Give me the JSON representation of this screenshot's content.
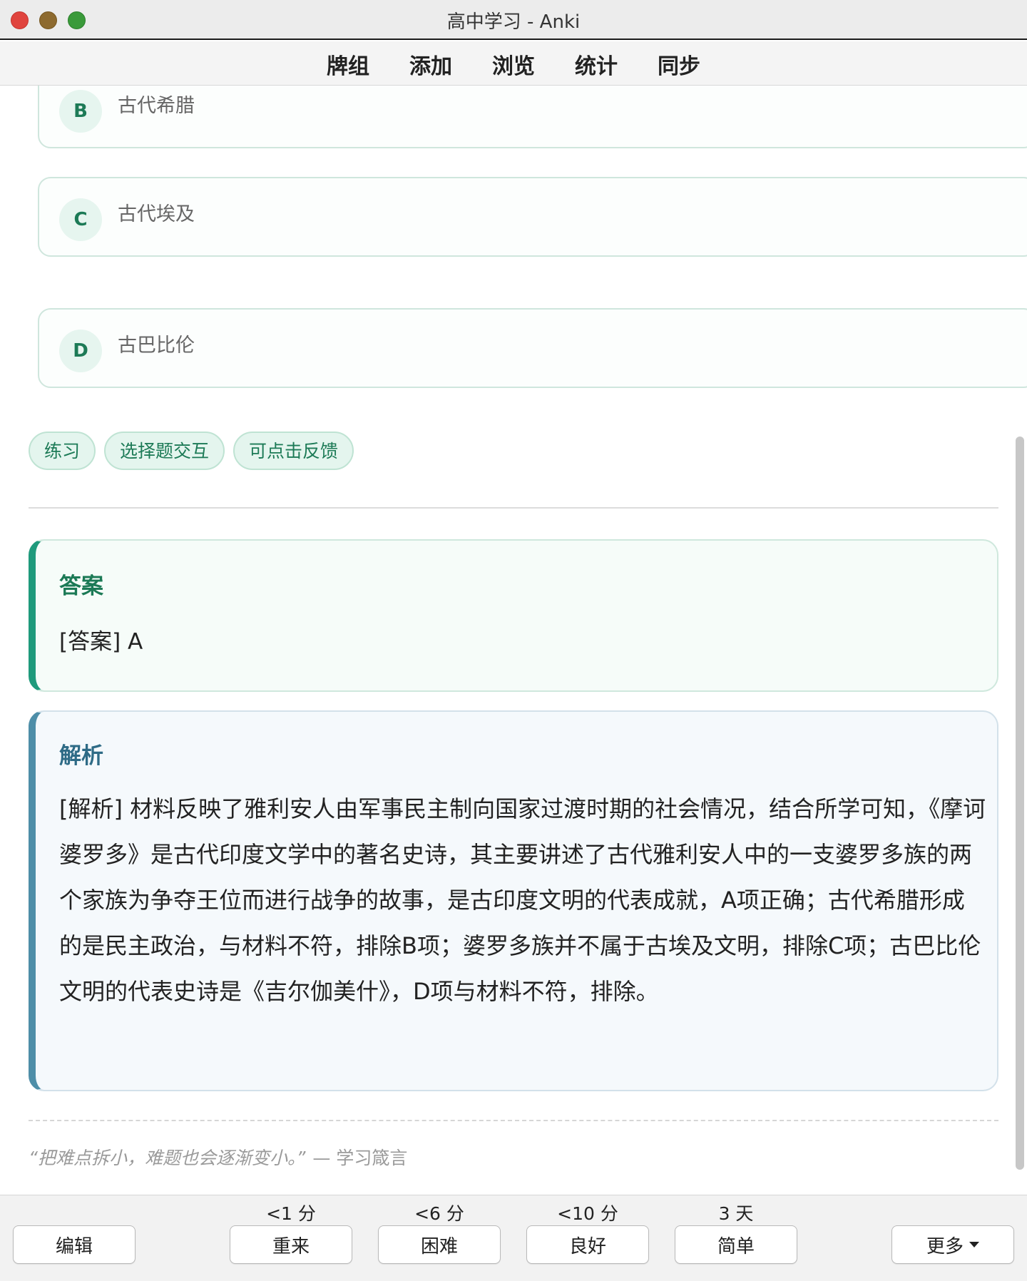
{
  "window": {
    "title": "高中学习 - Anki"
  },
  "toolbar": {
    "items": [
      "牌组",
      "添加",
      "浏览",
      "统计",
      "同步"
    ]
  },
  "card": {
    "options": [
      {
        "letter": "B",
        "text": "古代希腊"
      },
      {
        "letter": "C",
        "text": "古代埃及"
      },
      {
        "letter": "D",
        "text": "古巴比伦"
      }
    ],
    "tags": [
      "练习",
      "选择题交互",
      "可点击反馈"
    ],
    "answer": {
      "title": "答案",
      "text": "[答案] A"
    },
    "analysis": {
      "title": "解析",
      "text": "[解析] 材料反映了雅利安人由军事民主制向国家过渡时期的社会情况，结合所学可知，《摩诃婆罗多》是古代印度文学中的著名史诗，其主要讲述了古代雅利安人中的一支婆罗多族的两个家族为争夺王位而进行战争的故事，是古印度文明的代表成就，A项正确；古代希腊形成的是民主政治，与材料不符，排除B项；婆罗多族并不属于古埃及文明，排除C项；古巴比伦文明的代表史诗是《吉尔伽美什》，D项与材料不符，排除。"
    },
    "quote": {
      "text": "“把难点拆小，难题也会逐渐变小。”",
      "author": "— 学习箴言"
    }
  },
  "bottombar": {
    "edit_label": "编辑",
    "more_label": "更多",
    "answers": [
      {
        "label": "重来",
        "interval": "<1 分"
      },
      {
        "label": "困难",
        "interval": "<6 分"
      },
      {
        "label": "良好",
        "interval": "<10 分"
      },
      {
        "label": "简单",
        "interval": "3 天"
      }
    ]
  }
}
